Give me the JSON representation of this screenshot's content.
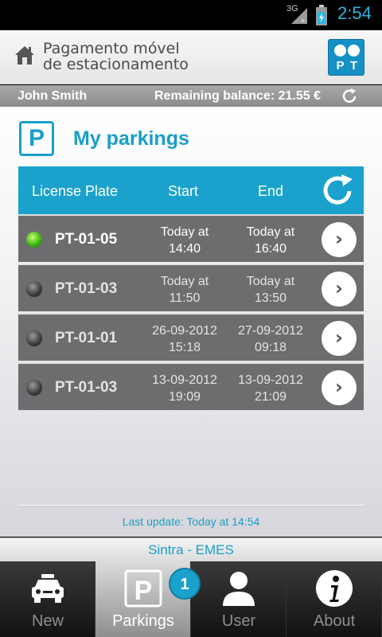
{
  "status_bar": {
    "network": "3G",
    "time": "2:54"
  },
  "header": {
    "title_line1": "Pagamento móvel",
    "title_line2": "de estacionamento",
    "logo_letters": [
      "P",
      "T"
    ]
  },
  "user_bar": {
    "name": "John Smith",
    "balance_text": "Remaining balance:  21.55 €"
  },
  "page": {
    "icon_letter": "P",
    "title": "My parkings"
  },
  "table": {
    "headers": [
      "License Plate",
      "Start",
      "End"
    ],
    "rows": [
      {
        "plate": "PT-01-05",
        "start_line1": "Today at",
        "start_line2": "14:40",
        "end_line1": "Today at",
        "end_line2": "16:40",
        "active": true
      },
      {
        "plate": "PT-01-03",
        "start_line1": "Today at",
        "start_line2": "11:50",
        "end_line1": "Today at",
        "end_line2": "13:50",
        "active": false
      },
      {
        "plate": "PT-01-01",
        "start_line1": "26-09-2012",
        "start_line2": "15:18",
        "end_line1": "27-09-2012",
        "end_line2": "09:18",
        "active": false
      },
      {
        "plate": "PT-01-03",
        "start_line1": "13-09-2012",
        "start_line2": "19:09",
        "end_line1": "13-09-2012",
        "end_line2": "21:09",
        "active": false
      }
    ]
  },
  "last_update": "Last update:  Today at 14:54",
  "location": "Sintra - EMES",
  "tabs": [
    {
      "label": "New",
      "icon": "car-icon"
    },
    {
      "label": "Parkings",
      "icon": "parking-icon",
      "badge": "1"
    },
    {
      "label": "User",
      "icon": "user-icon"
    },
    {
      "label": "About",
      "icon": "info-icon"
    }
  ],
  "colors": {
    "accent": "#1aa2cc",
    "row_bg": "#6d6d70",
    "active_led": "#3fb416"
  }
}
